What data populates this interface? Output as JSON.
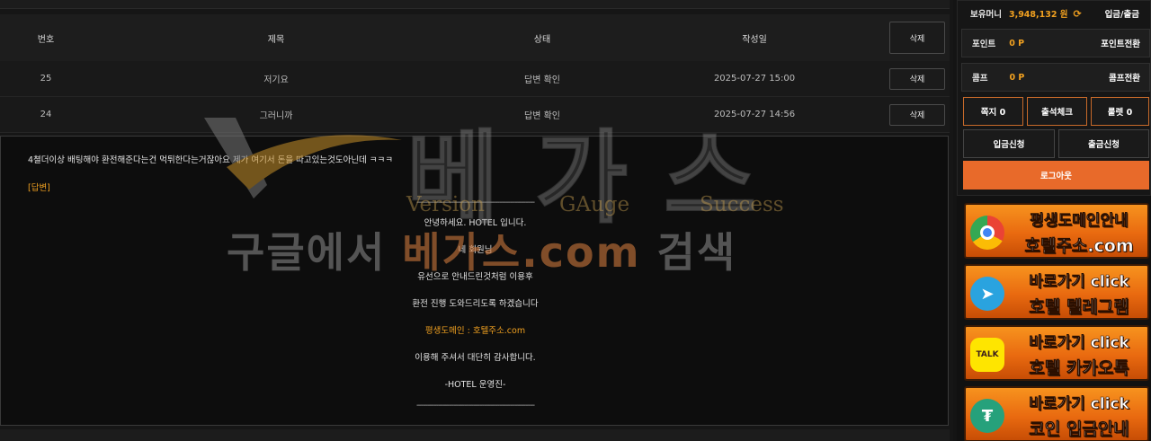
{
  "table": {
    "headers": {
      "num": "번호",
      "title": "제목",
      "status": "상태",
      "date": "작성일",
      "delete": "삭제"
    },
    "rows": [
      {
        "num": "25",
        "title": "저기요",
        "status": "답변 확인",
        "date": "2025-07-27 15:00",
        "delete": "삭제"
      },
      {
        "num": "24",
        "title": "그러니까",
        "status": "답변 확인",
        "date": "2025-07-27 14:56",
        "delete": "삭제"
      }
    ]
  },
  "detail": {
    "question": "4쳘더이상 배팅해야 환전해준다는건 먹튀한다는거잖아요 제가 여기서 돈을 따고있는것도아닌데 ㅋㅋㅋ",
    "answer_label": "[답변]",
    "answer_lines": [
      "------------------------------------------------------",
      "안녕하세요. HOTEL 입니다.",
      "네 회원님",
      "유선으로 안내드린것처럼 이용후",
      "환전 진행 도와드리도록 하겠습니다",
      "평생도메인 : 호텔주소.com",
      "이용해 주셔서 대단히 감사합니다.",
      "-HOTEL 운영진-",
      "------------------------------------------------------"
    ]
  },
  "watermark": {
    "big": "베가스",
    "sub1": "Version",
    "sub2": "GAuge",
    "sub3": "Success",
    "search_pre": "구글에서 ",
    "search_brand": "베가스.com",
    "search_post": " 검색"
  },
  "sidebar": {
    "money_label": "보유머니",
    "money_value": "3,948,132 원",
    "deposit_withdraw": "입금/출금",
    "point_label": "포인트",
    "point_value": "0 P",
    "point_convert": "포인트전환",
    "comp_label": "콤프",
    "comp_value": "0 P",
    "comp_convert": "콤프전환",
    "note": "쪽지 0",
    "attendance": "출석체크",
    "roulette": "룰렛 0",
    "deposit_apply": "입금신청",
    "withdraw_apply": "출금신청",
    "logout": "로그아웃"
  },
  "banners": [
    {
      "line1": "평생도메인안내",
      "line2": "호텔주소.com"
    },
    {
      "line1": "바로가기 click",
      "line2": "호텔 텔레그램"
    },
    {
      "line1": "바로가기 click",
      "line2": "호텔 카카오톡"
    },
    {
      "line1": "바로가기 click",
      "line2": "코인 입금안내"
    }
  ],
  "colors": {
    "accent": "#f0a020",
    "orange": "#e86a2a",
    "bg": "#161616"
  }
}
